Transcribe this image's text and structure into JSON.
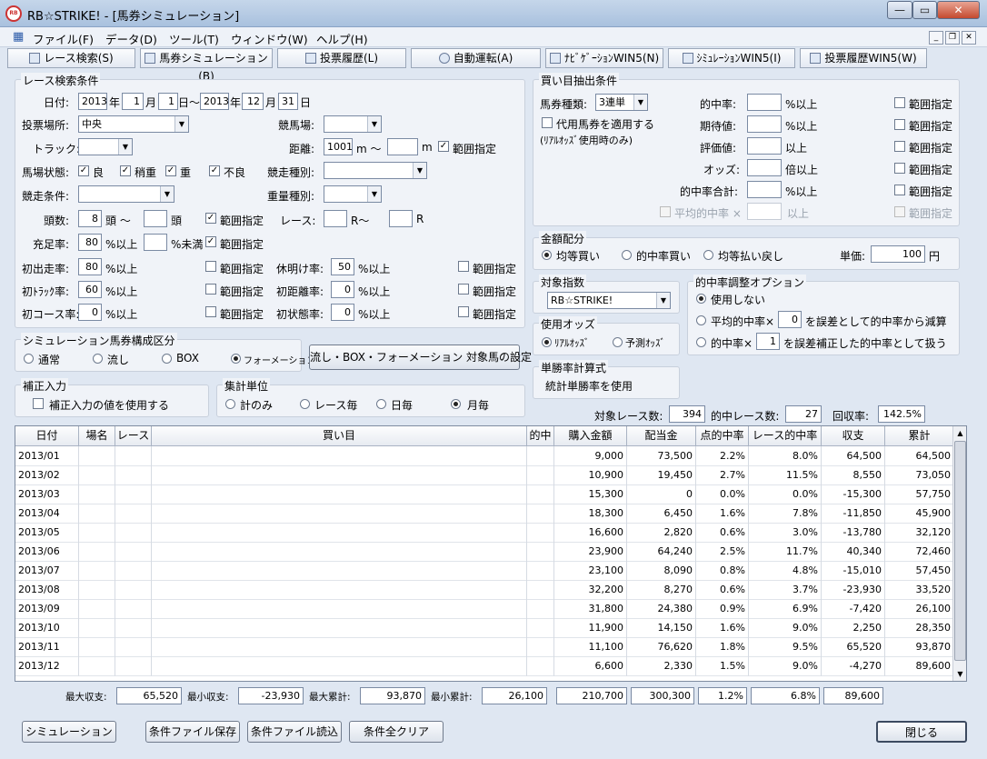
{
  "window": {
    "title": "RB☆STRIKE! - [馬券シミュレーション]",
    "app_icon_label": "RB"
  },
  "menu": [
    "ファイル(F)",
    "データ(D)",
    "ツール(T)",
    "ウィンドウ(W)",
    "ヘルプ(H)"
  ],
  "tabs": [
    "レース検索(S)",
    "馬券シミュレーション(B)",
    "投票履歴(L)",
    "自動運転(A)",
    "ﾅﾋﾞｹﾞｰｼｮﾝWIN5(N)",
    "ｼﾐｭﾚｰｼｮﾝWIN5(I)",
    "投票履歴WIN5(W)"
  ],
  "search": {
    "title": "レース検索条件",
    "date_label": "日付:",
    "from_year": "2013",
    "from_month": "1",
    "from_day": "1",
    "to_year": "2013",
    "to_month": "12",
    "to_day": "31",
    "u_year": "年",
    "u_month": "月",
    "u_day_tilde": "日〜",
    "u_day": "日",
    "venue_label": "投票場所:",
    "venue_value": "中央",
    "track_label": "競馬場:",
    "course_label": "トラック:",
    "distance_label": "距離:",
    "distance_from": "1001",
    "distance_unit1": "m 〜",
    "distance_unit2": "m",
    "range": "範囲指定",
    "condition_label": "馬場状態:",
    "cond_good": "良",
    "cond_slightly": "稍重",
    "cond_heavy": "重",
    "cond_bad": "不良",
    "race_type_label": "競走種別:",
    "race_cond_label": "競走条件:",
    "weight_label": "重量種別:",
    "heads_label": "頭数:",
    "heads_from": "8",
    "heads_u1": "頭 〜",
    "heads_u2": "頭",
    "race_label": "レース:",
    "race_u1": "R〜",
    "race_u2": "R",
    "fill_label": "充足率:",
    "fill_value": "80",
    "fill_u1": "%以上",
    "fill_u2": "%未満",
    "first_label": "初出走率:",
    "first_value": "80",
    "pct_over": "%以上",
    "rest_label": "休明け率:",
    "rest_value": "50",
    "ftrack_label": "初ﾄﾗｯｸ率:",
    "ftrack_value": "60",
    "fdist_label": "初距離率:",
    "fdist_value": "0",
    "fcourse_label": "初コース率:",
    "fcourse_value": "0",
    "fstate_label": "初状態率:",
    "fstate_value": "0"
  },
  "buy": {
    "title": "買い目抽出条件",
    "kind_label": "馬券種類:",
    "kind_value": "3連単",
    "sub_label": "代用馬券を適用する",
    "sub_note": "(ﾘｱﾙｵｯｽﾞ使用時のみ)",
    "hit_label": "的中率:",
    "hit_unit": "%以上",
    "exp_label": "期待値:",
    "exp_unit": "%以上",
    "eval_label": "評価値:",
    "eval_unit": "以上",
    "odds_label": "オッズ:",
    "odds_unit": "倍以上",
    "hitsum_label": "的中率合計:",
    "hitsum_unit": "%以上",
    "avg_label": "平均的中率 ×",
    "avg_unit": "以上",
    "range": "範囲指定"
  },
  "money": {
    "title": "金額配分",
    "opt1": "均等買い",
    "opt2": "的中率買い",
    "opt3": "均等払い戻し",
    "unit_label": "単価:",
    "unit_value": "100",
    "unit_suffix": "円"
  },
  "target": {
    "title": "対象指数",
    "value": "RB☆STRIKE!"
  },
  "odds": {
    "title": "使用オッズ",
    "real": "ﾘｱﾙｵｯｽﾞ",
    "pred": "予測ｵｯｽﾞ"
  },
  "adjust": {
    "title": "的中率調整オプション",
    "opt1": "使用しない",
    "opt2_a": "平均的中率×",
    "opt2_v": "0",
    "opt2_b": "を誤差として的中率から減算",
    "opt3_a": "的中率×",
    "opt3_v": "1",
    "opt3_b": "を誤差補正した的中率として扱う"
  },
  "formula": {
    "title": "単勝率計算式",
    "value": "統計単勝率を使用"
  },
  "sim": {
    "title": "シミュレーション馬券構成区分",
    "opt1": "通常",
    "opt2": "流し",
    "opt3": "BOX",
    "opt4": "フォーメーション",
    "button": "流し・BOX・フォーメーション 対象馬の設定"
  },
  "correction": {
    "title": "補正入力",
    "check": "補正入力の値を使用する"
  },
  "unit": {
    "title": "集計単位",
    "opt1": "計のみ",
    "opt2": "レース毎",
    "opt3": "日毎",
    "opt4": "月毎"
  },
  "stats": {
    "races_label": "対象レース数:",
    "races": "394",
    "hit_label": "的中レース数:",
    "hit": "27",
    "ret_label": "回収率:",
    "ret": "142.5%"
  },
  "table": {
    "headers": [
      "日付",
      "場名",
      "レース",
      "買い目",
      "的中",
      "購入金額",
      "配当金",
      "点的中率",
      "レース的中率",
      "収支",
      "累計"
    ],
    "rows": [
      [
        "2013/01",
        "",
        "",
        "",
        "",
        "9,000",
        "73,500",
        "2.2%",
        "8.0%",
        "64,500",
        "64,500"
      ],
      [
        "2013/02",
        "",
        "",
        "",
        "",
        "10,900",
        "19,450",
        "2.7%",
        "11.5%",
        "8,550",
        "73,050"
      ],
      [
        "2013/03",
        "",
        "",
        "",
        "",
        "15,300",
        "0",
        "0.0%",
        "0.0%",
        "-15,300",
        "57,750"
      ],
      [
        "2013/04",
        "",
        "",
        "",
        "",
        "18,300",
        "6,450",
        "1.6%",
        "7.8%",
        "-11,850",
        "45,900"
      ],
      [
        "2013/05",
        "",
        "",
        "",
        "",
        "16,600",
        "2,820",
        "0.6%",
        "3.0%",
        "-13,780",
        "32,120"
      ],
      [
        "2013/06",
        "",
        "",
        "",
        "",
        "23,900",
        "64,240",
        "2.5%",
        "11.7%",
        "40,340",
        "72,460"
      ],
      [
        "2013/07",
        "",
        "",
        "",
        "",
        "23,100",
        "8,090",
        "0.8%",
        "4.8%",
        "-15,010",
        "57,450"
      ],
      [
        "2013/08",
        "",
        "",
        "",
        "",
        "32,200",
        "8,270",
        "0.6%",
        "3.7%",
        "-23,930",
        "33,520"
      ],
      [
        "2013/09",
        "",
        "",
        "",
        "",
        "31,800",
        "24,380",
        "0.9%",
        "6.9%",
        "-7,420",
        "26,100"
      ],
      [
        "2013/10",
        "",
        "",
        "",
        "",
        "11,900",
        "14,150",
        "1.6%",
        "9.0%",
        "2,250",
        "28,350"
      ],
      [
        "2013/11",
        "",
        "",
        "",
        "",
        "11,100",
        "76,620",
        "1.8%",
        "9.5%",
        "65,520",
        "93,870"
      ],
      [
        "2013/12",
        "",
        "",
        "",
        "",
        "6,600",
        "2,330",
        "1.5%",
        "9.0%",
        "-4,270",
        "89,600"
      ]
    ]
  },
  "summary": {
    "max_inc_label": "最大収支:",
    "max_inc": "65,520",
    "min_inc_label": "最小収支:",
    "min_inc": "-23,930",
    "max_cum_label": "最大累計:",
    "max_cum": "93,870",
    "min_cum_label": "最小累計:",
    "min_cum": "26,100",
    "buy_total": "210,700",
    "pay_total": "300,300",
    "pt_hit": "1.2%",
    "race_hit": "6.8%",
    "total": "89,600"
  },
  "buttons": {
    "simulate": "シミュレーション",
    "save": "条件ファイル保存",
    "load": "条件ファイル読込",
    "clear": "条件全クリア",
    "close": "閉じる"
  }
}
